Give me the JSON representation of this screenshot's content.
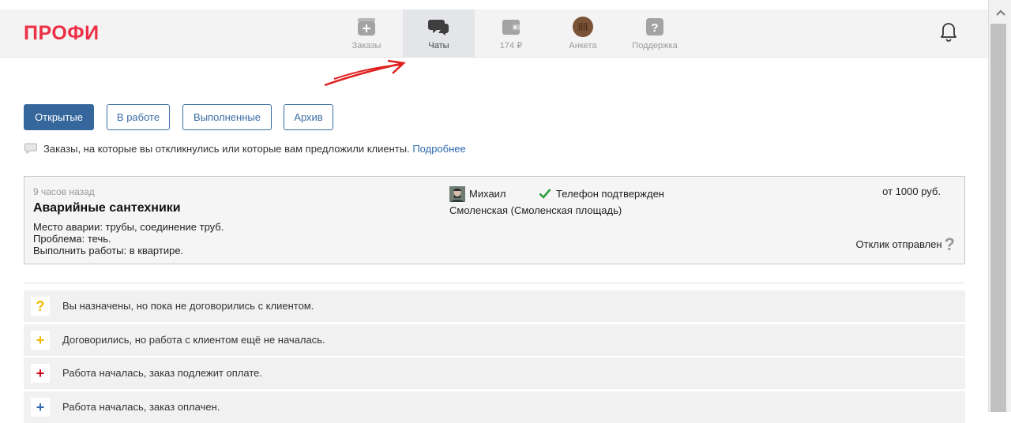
{
  "header": {
    "logo": "ПРОФИ",
    "nav": [
      {
        "label": "Заказы",
        "icon": "orders-icon"
      },
      {
        "label": "Чаты",
        "icon": "chat-icon",
        "active": true
      },
      {
        "label": "174 ₽",
        "icon": "wallet-icon"
      },
      {
        "label": "Анкета",
        "icon": "avatar-icon"
      },
      {
        "label": "Поддержка",
        "icon": "help-icon"
      }
    ],
    "bell_icon": "bell-icon"
  },
  "tabs": [
    {
      "label": "Открытые",
      "active": true
    },
    {
      "label": "В работе"
    },
    {
      "label": "Выполненные"
    },
    {
      "label": "Архив"
    }
  ],
  "info": {
    "text": "Заказы, на которые вы откликнулись или которые вам предложили клиенты.",
    "link": "Подробнее"
  },
  "order": {
    "time": "9 часов назад",
    "title": "Аварийные сантехники",
    "desc": [
      "Место аварии: трубы, соединение труб.",
      "Проблема: течь.",
      "Выполнить работы: в квартире."
    ],
    "client_name": "Михаил",
    "phone_status": "Телефон подтвержден",
    "location": "Смоленская (Смоленская площадь)",
    "price": "от 1000 руб.",
    "status": "Отклик отправлен",
    "status_help": "?"
  },
  "legend": [
    {
      "symbol": "?",
      "color": "#f5b800",
      "text": "Вы назначены, но пока не договорились с клиентом."
    },
    {
      "symbol": "+",
      "color": "#f5b800",
      "text": "Договорились, но работа с клиентом ещё не началась."
    },
    {
      "symbol": "+",
      "color": "#d0021b",
      "text": "Работа началась, заказ подлежит оплате."
    },
    {
      "symbol": "+",
      "color": "#2e6bb0",
      "text": "Работа началась, заказ оплачен."
    }
  ],
  "colors": {
    "brand": "#ee2f45",
    "accent": "#35679c",
    "link": "#2e6bb0"
  }
}
